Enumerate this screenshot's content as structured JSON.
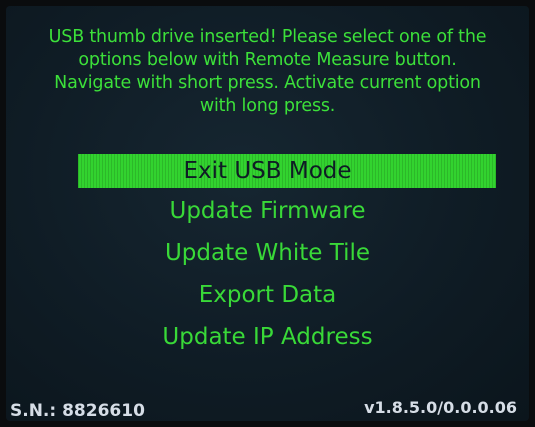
{
  "message": {
    "lines": [
      "USB thumb drive inserted! Please select one of the",
      "options below with Remote Measure button.",
      "Navigate with short press. Activate current option",
      "with long press."
    ]
  },
  "menu": {
    "items": [
      {
        "label": "Exit USB Mode",
        "selected": true
      },
      {
        "label": "Update Firmware",
        "selected": false
      },
      {
        "label": "Update White Tile",
        "selected": false
      },
      {
        "label": "Export Data",
        "selected": false
      },
      {
        "label": "Update IP Address",
        "selected": false
      }
    ]
  },
  "footer": {
    "serial": "S.N.: 8826610",
    "version": "v1.8.5.0/0.0.0.06"
  },
  "colors": {
    "text_green": "#3ce03a",
    "highlight_green": "#32d32f",
    "screen_bg": "#0f1c25",
    "footer_text": "#d6dde6"
  }
}
